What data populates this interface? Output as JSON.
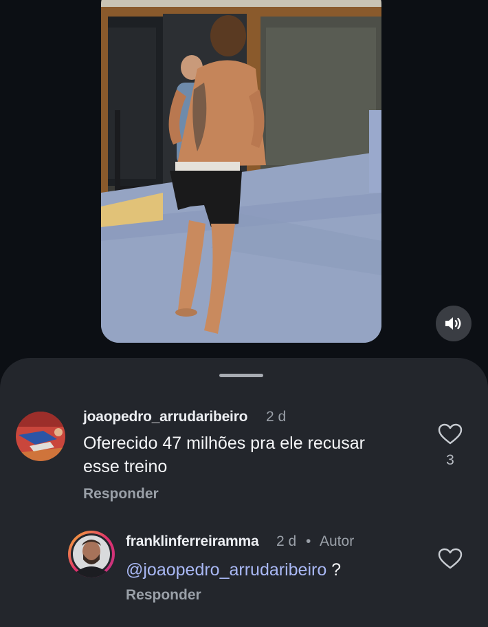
{
  "comments": [
    {
      "username": "joaopedro_arrudaribeiro",
      "time": "2 d",
      "text_line1": "Oferecido 47 milhões pra ele recusar",
      "text_line2": "esse treino",
      "reply_label": "Responder",
      "likes": "3"
    },
    {
      "username": "franklinferreiramma",
      "time": "2 d",
      "separator": "•",
      "author_tag": "Autor",
      "mention": "@joaopedro_arrudaribeiro",
      "text_after": " ?",
      "reply_label": "Responder"
    }
  ],
  "icons": {
    "sound": "speaker-icon",
    "like": "heart-outline-icon"
  },
  "colors": {
    "background": "#0c0f14",
    "sheet": "#23262c",
    "mention": "#a9b8f5",
    "muted": "#9aa0a8"
  }
}
